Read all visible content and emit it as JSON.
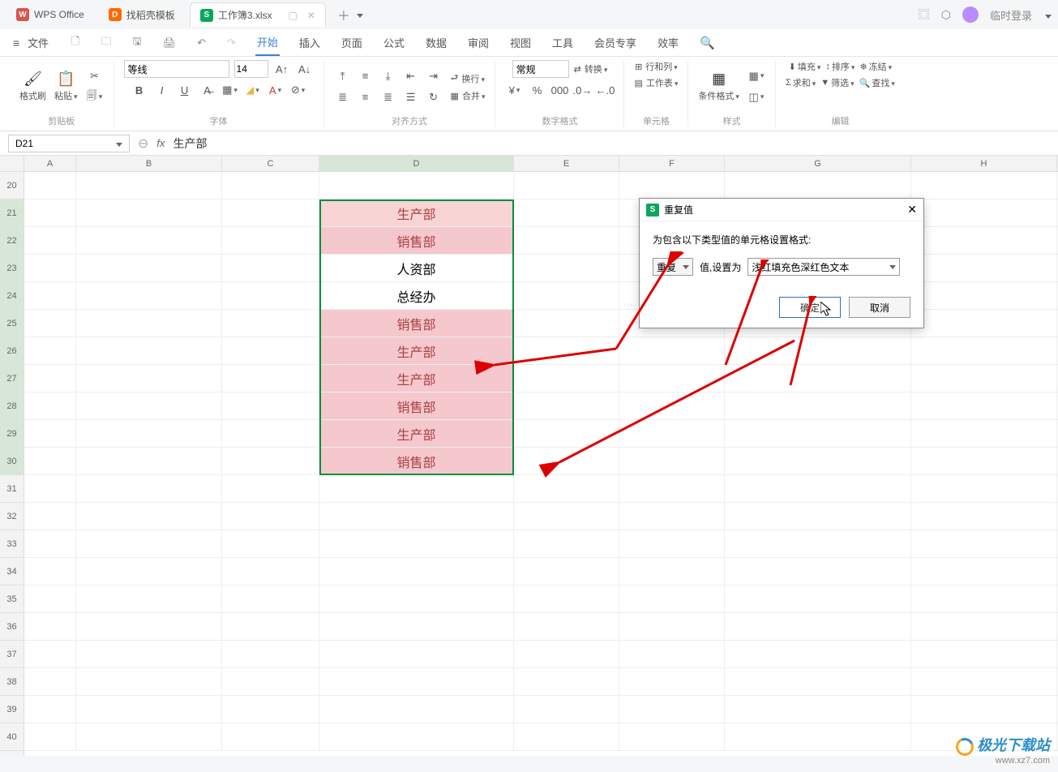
{
  "titlebar": {
    "app_tab": "WPS Office",
    "template_tab": "找稻壳模板",
    "file_tab": "工作簿3.xlsx",
    "login": "临时登录"
  },
  "menu": {
    "file": "文件",
    "start": "开始",
    "insert": "插入",
    "page": "页面",
    "formula": "公式",
    "data": "数据",
    "review": "审阅",
    "view": "视图",
    "tools": "工具",
    "member": "会员专享",
    "efficiency": "效率"
  },
  "ribbon": {
    "clipboard_label": "剪贴板",
    "format_painter": "格式刷",
    "paste": "粘贴",
    "font_label": "字体",
    "font_name": "等线",
    "font_size": "14",
    "align_label": "对齐方式",
    "wrap": "换行",
    "merge": "合并",
    "number_label": "数字格式",
    "number_general": "常规",
    "convert": "转换",
    "cell_label": "单元格",
    "rowcol": "行和列",
    "worksheet": "工作表",
    "style_label": "样式",
    "cond_format": "条件格式",
    "edit_label": "编辑",
    "fill": "填充",
    "sort": "排序",
    "freeze": "冻结",
    "sum": "求和",
    "filter": "筛选",
    "find": "查找"
  },
  "formula": {
    "cell_ref": "D21",
    "value": "生产部"
  },
  "columns": [
    "B",
    "C",
    "D",
    "E",
    "F",
    "G",
    "H"
  ],
  "rows": [
    "20",
    "21",
    "22",
    "23",
    "24",
    "25",
    "26",
    "27",
    "28",
    "29",
    "30",
    "31",
    "32",
    "33",
    "34",
    "35",
    "36",
    "37",
    "38",
    "39",
    "40"
  ],
  "data_D": {
    "21": {
      "v": "生产部",
      "hl": "lightpink"
    },
    "22": {
      "v": "销售部",
      "hl": "highlight"
    },
    "23": {
      "v": "人资部",
      "hl": ""
    },
    "24": {
      "v": "总经办",
      "hl": ""
    },
    "25": {
      "v": "销售部",
      "hl": "highlight"
    },
    "26": {
      "v": "生产部",
      "hl": "highlight"
    },
    "27": {
      "v": "生产部",
      "hl": "highlight"
    },
    "28": {
      "v": "销售部",
      "hl": "highlight"
    },
    "29": {
      "v": "生产部",
      "hl": "highlight"
    },
    "30": {
      "v": "销售部",
      "hl": "highlight"
    }
  },
  "dialog": {
    "title": "重复值",
    "description": "为包含以下类型值的单元格设置格式:",
    "type": "重复",
    "set_as": "值,设置为",
    "format": "浅红填充色深红色文本",
    "ok": "确定",
    "cancel": "取消"
  },
  "watermark": {
    "text": "极光下载站",
    "url": "www.xz7.com"
  }
}
